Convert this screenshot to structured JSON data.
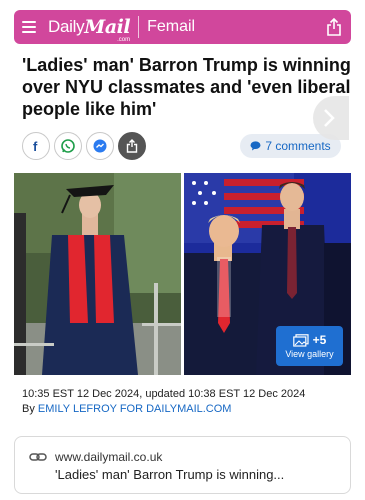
{
  "header": {
    "brand_daily": "Daily",
    "brand_mail": "Mail",
    "brand_com": ".com",
    "section": "Femail",
    "accent_color": "#d1479c"
  },
  "article": {
    "headline": "'Ladies' man' Barron Trump is winning over NYU classmates and 'even liberal people like him'",
    "comments_label": "7 comments",
    "timestamp": "10:35 EST 12 Dec 2024, updated 10:38 EST 12 Dec 2024",
    "byline_prefix": "By ",
    "byline_author": "EMILY LEFROY FOR DAILYMAIL.COM"
  },
  "share_buttons": [
    {
      "name": "facebook-icon"
    },
    {
      "name": "whatsapp-icon"
    },
    {
      "name": "messenger-icon"
    },
    {
      "name": "share-icon"
    }
  ],
  "gallery": {
    "count_label": "+5",
    "view_label": "View gallery"
  },
  "link_preview": {
    "domain": "www.dailymail.co.uk",
    "title": "'Ladies' man' Barron Trump is winning..."
  },
  "colors": {
    "link_blue": "#1768c4",
    "gallery_button": "#1f6fd1",
    "comments_bg": "#e7ecf3"
  }
}
